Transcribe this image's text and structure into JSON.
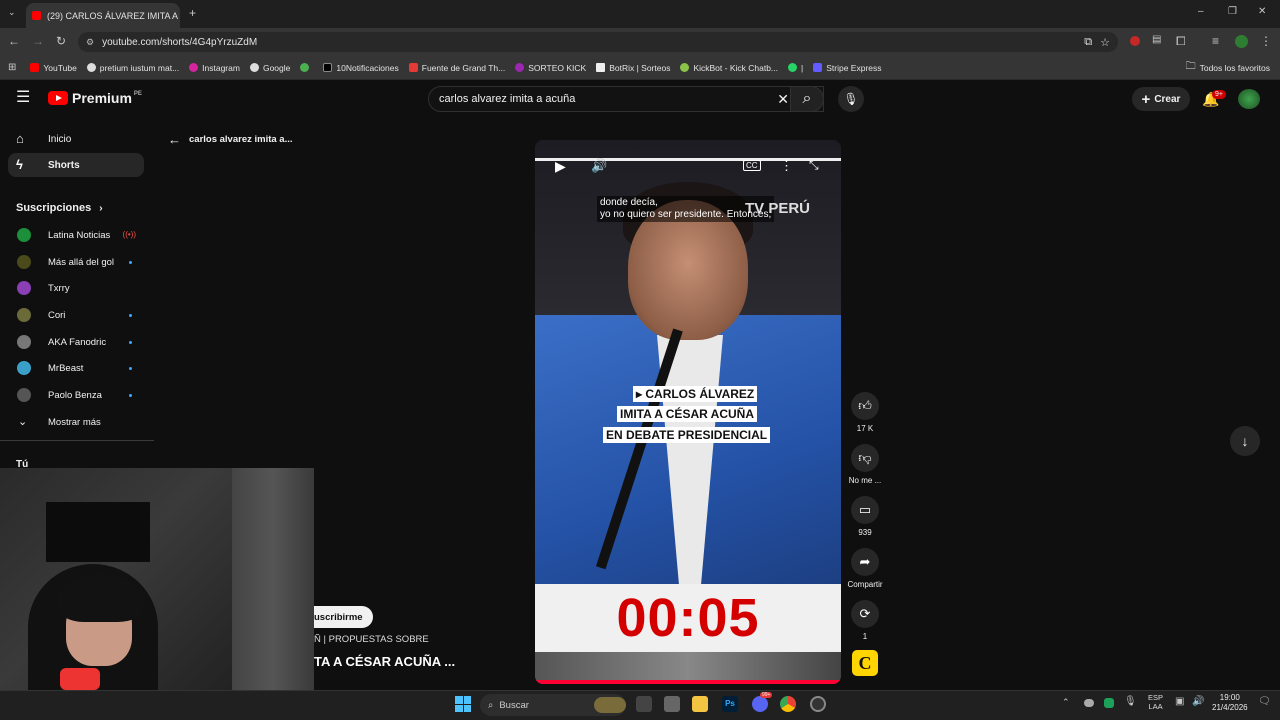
{
  "browser": {
    "tab_title": "(29) CARLOS ÁLVAREZ IMITA A",
    "url": "youtube.com/shorts/4G4pYrzuZdM",
    "bookmarks": [
      "YouTube",
      "pretium iustum mat...",
      "Instagram",
      "Google",
      "",
      "10Notificaciones",
      "Fuente de Grand Th...",
      "SORTEO KICK",
      "BotRix | Sorteos",
      "KickBot - Kick Chatb...",
      "|",
      "Stripe Express"
    ],
    "all_bookmarks": "Todos los favoritos"
  },
  "youtube": {
    "logo": "Premium",
    "region": "PE",
    "search_query": "carlos alvarez imita a acuña",
    "create_label": "Crear",
    "notif_badge": "9+"
  },
  "sidebar": {
    "home": "Inicio",
    "shorts": "Shorts",
    "subs_header": "Suscripciones",
    "subscriptions": [
      {
        "name": "Latina Noticias",
        "color": "#1c8f3a"
      },
      {
        "name": "Más allá del gol",
        "color": "#4a4a1a"
      },
      {
        "name": "Txrry",
        "color": "#8a3fb5"
      },
      {
        "name": "Cori",
        "color": "#6b6b3a"
      },
      {
        "name": "AKA Fanodric",
        "color": "#777777"
      },
      {
        "name": "MrBeast",
        "color": "#3aa0c7"
      },
      {
        "name": "Paolo Benza",
        "color": "#555555"
      }
    ],
    "show_more": "Mostrar más",
    "you": "Tú"
  },
  "short": {
    "back_title": "carlos alvarez imita a...",
    "subtitle_line1": "donde decía,",
    "subtitle_line2": "yo no quiero ser presidente. Entonces,",
    "watermark": "TV PERÚ",
    "caption_line1": "▸ CARLOS ÁLVAREZ",
    "caption_line2": "IMITA A CÉSAR ACUÑA",
    "caption_line3": "EN DEBATE PRESIDENCIAL",
    "timer": "00:05",
    "subscribe": "uscribirme",
    "desc_line1": "Ñ | PROPUESTAS SOBRE",
    "desc_line2": "TA A CÉSAR ACUÑA ...",
    "channel_initial": "C"
  },
  "actions": {
    "likes": "17 K",
    "dislike": "No me ...",
    "comments": "939",
    "share": "Compartir",
    "remix": "1"
  },
  "taskbar": {
    "search": "Buscar",
    "lang1": "ESP",
    "lang2": "LAA",
    "time": "19:00",
    "date": "21/4/2026",
    "notif_badge": "99+"
  }
}
